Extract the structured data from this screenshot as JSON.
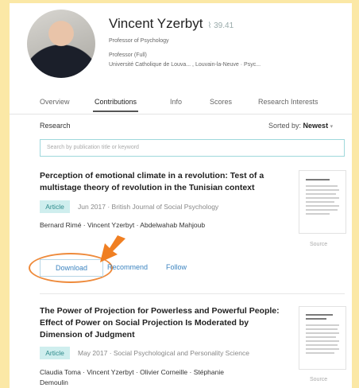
{
  "profile": {
    "name": "Vincent Yzerbyt",
    "score": "39.41",
    "position": "Professor of Psychology",
    "degree": "Professor (Full)",
    "affiliation": "Université Catholique de Louva... , Louvain-la-Neuve · Psyc..."
  },
  "tabs": [
    "Overview",
    "Contributions",
    "Info",
    "Scores",
    "Research Interests"
  ],
  "research": {
    "label": "Research",
    "sort_label": "Sorted by:",
    "sort_value": "Newest",
    "search_placeholder": "Search by publication title or keyword"
  },
  "publications": [
    {
      "title": "Perception of emotional climate in a revolution: Test of a multistage theory of revolution in the Tunisian context",
      "type": "Article",
      "meta": "Jun 2017 · British Journal of Social Psychology",
      "authors": "Bernard Rimé · Vincent Yzerbyt · Abdelwahab Mahjoub",
      "source": "Source"
    },
    {
      "title": "The Power of Projection for Powerless and Powerful People: Effect of Power on Social Projection Is Moderated by Dimension of Judgment",
      "type": "Article",
      "meta": "May 2017 · Social Psychological and Personality Science",
      "authors": "Claudia Toma · Vincent Yzerbyt · Olivier Corneille · Stéphanie",
      "authors_cont": "Demoulin",
      "source": "Source"
    }
  ],
  "actions": {
    "download": "Download",
    "recommend": "Recommend",
    "follow": "Follow"
  },
  "colors": {
    "highlight_ring": "#ee8a3b",
    "arrow": "#f07f22",
    "badge_bg": "#cfeeee",
    "link": "#3c84c0",
    "page_bg": "#fbe8a6"
  },
  "icons": [
    "score-icon",
    "chevron-down-icon",
    "annotation-arrow-icon"
  ]
}
